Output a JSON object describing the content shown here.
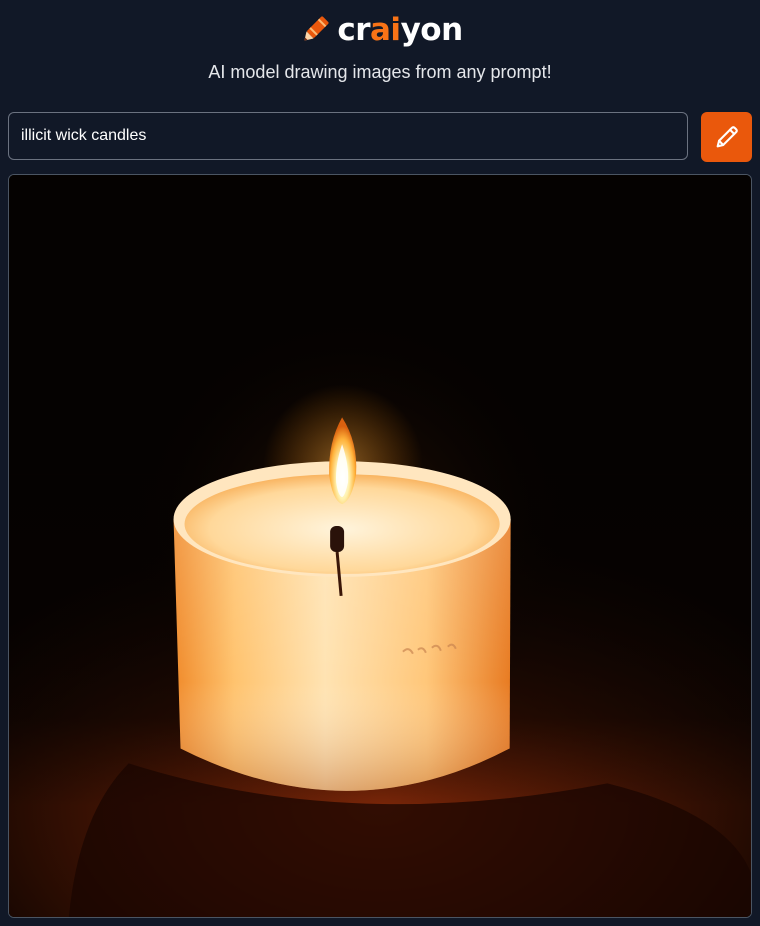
{
  "app": {
    "logo": {
      "prefix": "cr",
      "accent": "ai",
      "suffix": "yon",
      "icon": "crayon-icon"
    },
    "tagline": "AI model drawing images from any prompt!"
  },
  "prompt": {
    "value": "illicit wick candles",
    "placeholder": ""
  },
  "draw_button": {
    "icon": "pencil-icon",
    "aria_label": "Draw"
  },
  "result": {
    "image_subject": "lit candle in glass jar"
  },
  "colors": {
    "background": "#111827",
    "accent": "#ea580c",
    "logo_accent": "#f97316"
  }
}
